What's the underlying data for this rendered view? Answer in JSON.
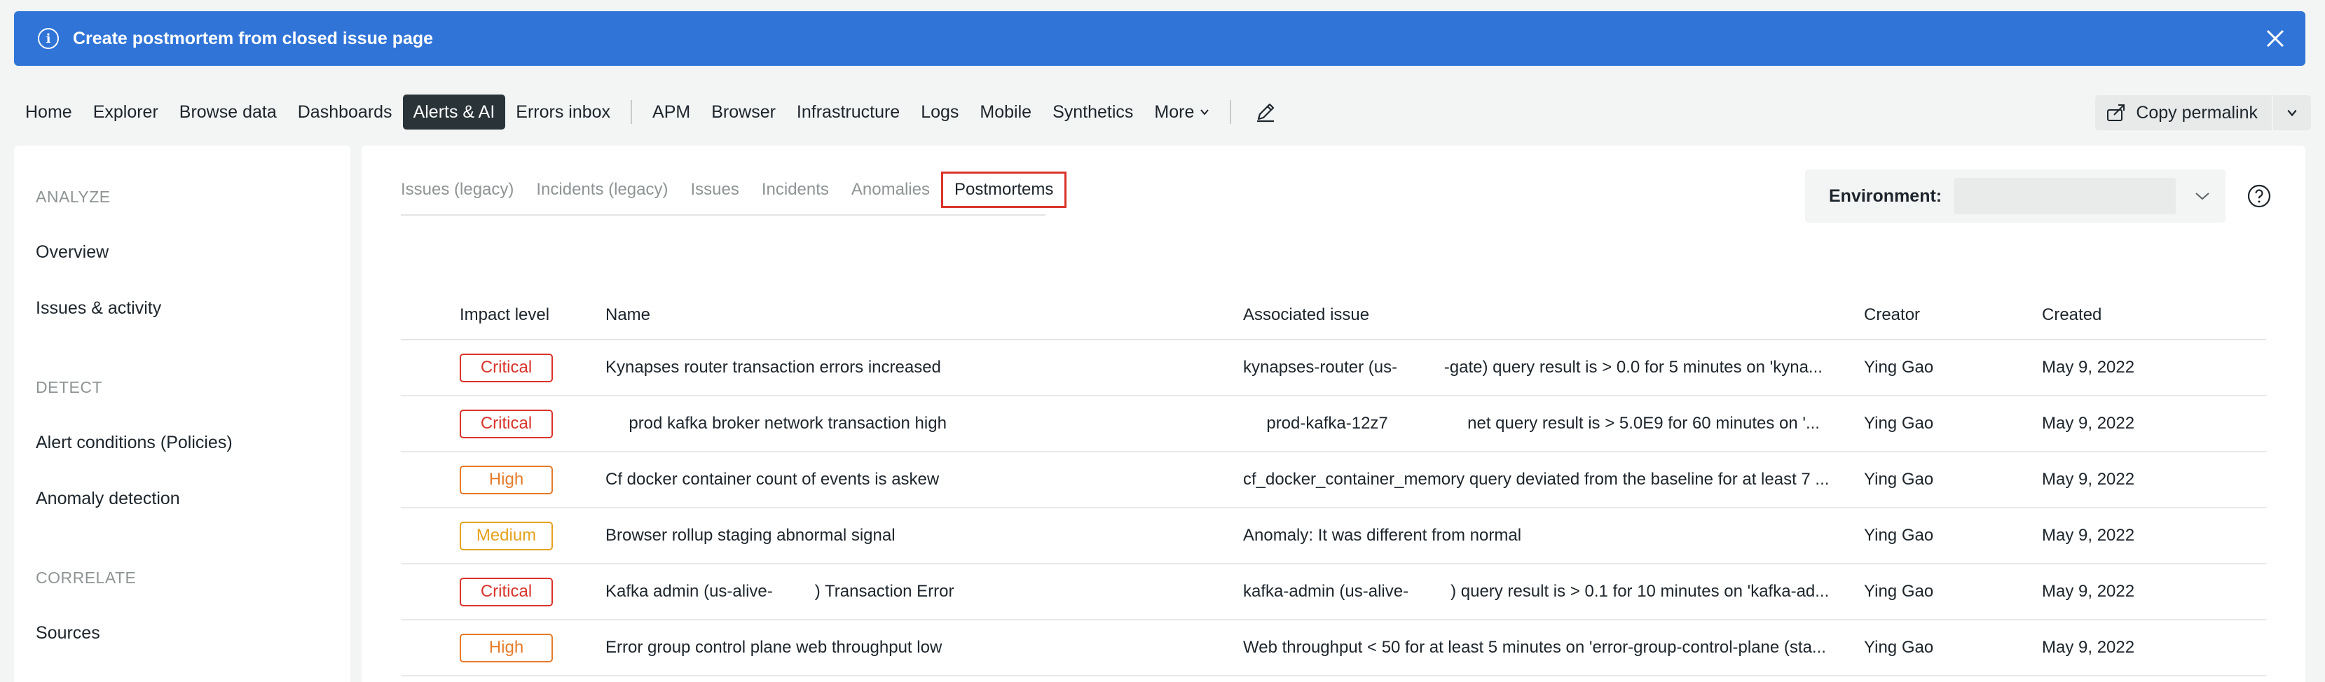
{
  "banner": {
    "title": "Create postmortem from closed issue page"
  },
  "nav": {
    "items": [
      {
        "label": "Home",
        "active": false
      },
      {
        "label": "Explorer",
        "active": false
      },
      {
        "label": "Browse data",
        "active": false
      },
      {
        "label": "Dashboards",
        "active": false
      },
      {
        "label": "Alerts & AI",
        "active": true
      },
      {
        "label": "Errors inbox",
        "active": false
      }
    ],
    "items2": [
      {
        "label": "APM"
      },
      {
        "label": "Browser"
      },
      {
        "label": "Infrastructure"
      },
      {
        "label": "Logs"
      },
      {
        "label": "Mobile"
      },
      {
        "label": "Synthetics"
      }
    ],
    "more_label": "More",
    "permalink_label": "Copy permalink"
  },
  "sidebar": {
    "sections": [
      {
        "heading": "ANALYZE",
        "items": [
          "Overview",
          "Issues & activity"
        ]
      },
      {
        "heading": "DETECT",
        "items": [
          "Alert conditions (Policies)",
          "Anomaly detection"
        ]
      },
      {
        "heading": "CORRELATE",
        "items": [
          "Sources"
        ]
      }
    ]
  },
  "tabs": [
    {
      "label": "Issues (legacy)",
      "active": false
    },
    {
      "label": "Incidents (legacy)",
      "active": false
    },
    {
      "label": "Issues",
      "active": false
    },
    {
      "label": "Incidents",
      "active": false
    },
    {
      "label": "Anomalies",
      "active": false
    },
    {
      "label": "Postmortems",
      "active": true
    }
  ],
  "environment": {
    "label": "Environment:",
    "value": ""
  },
  "table": {
    "headers": {
      "impact": "Impact level",
      "name": "Name",
      "associated": "Associated issue",
      "creator": "Creator",
      "created": "Created"
    },
    "rows": [
      {
        "impact": "Critical",
        "name": "Kynapses router transaction errors increased",
        "associated": "kynapses-router (us-          -gate) query result is > 0.0 for 5 minutes on 'kyna...",
        "creator": "Ying Gao",
        "created": "May 9, 2022"
      },
      {
        "impact": "Critical",
        "name": "     prod kafka broker network transaction high",
        "associated": "     prod-kafka-12z7                 net query result is > 5.0E9 for 60 minutes on '...",
        "creator": "Ying Gao",
        "created": "May 9, 2022"
      },
      {
        "impact": "High",
        "name": "Cf docker container count of events is askew",
        "associated": "cf_docker_container_memory query deviated from the baseline for at least 7 ...",
        "creator": "Ying Gao",
        "created": "May 9, 2022"
      },
      {
        "impact": "Medium",
        "name": "Browser rollup staging abnormal signal",
        "associated": "Anomaly: It was different from normal",
        "creator": "Ying Gao",
        "created": "May 9, 2022"
      },
      {
        "impact": "Critical",
        "name": "Kafka admin (us-alive-         ) Transaction Error",
        "associated": "kafka-admin (us-alive-         ) query result is > 0.1 for 10 minutes on 'kafka-ad...",
        "creator": "Ying Gao",
        "created": "May 9, 2022"
      },
      {
        "impact": "High",
        "name": "Error group control plane web throughput low",
        "associated": "Web throughput < 50 for at least 5 minutes on 'error-group-control-plane (sta...",
        "creator": "Ying Gao",
        "created": "May 9, 2022"
      }
    ]
  },
  "colors": {
    "banner": "#3074d8",
    "critical": "#d9342b",
    "high": "#e57b2a",
    "medium": "#e6a21f",
    "active_tab_outline": "#d9342b"
  },
  "icons": {
    "banner_info": "info-circle-icon",
    "banner_close": "close-icon",
    "edit": "pencil-icon",
    "permalink": "share-link-icon",
    "help": "help-circle-icon"
  }
}
